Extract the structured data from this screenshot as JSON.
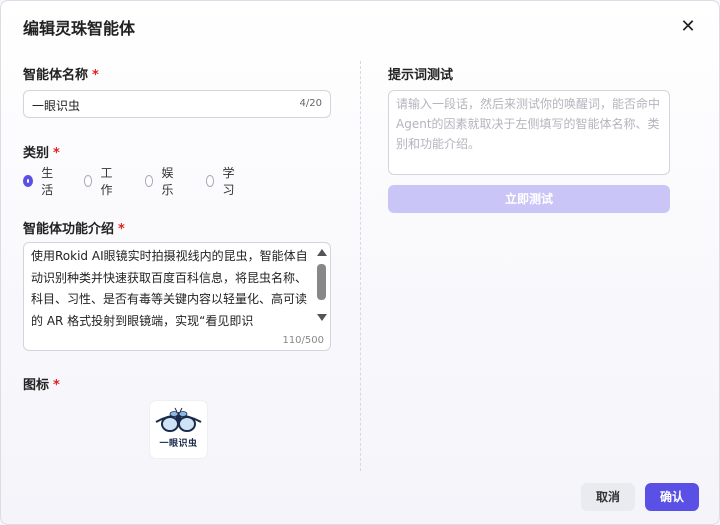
{
  "dialog": {
    "title": "编辑灵珠智能体",
    "close_symbol": "✕"
  },
  "name_field": {
    "label": "智能体名称",
    "required_mark": "*",
    "value": "一眼识虫",
    "counter": "4/20"
  },
  "category": {
    "label": "类别",
    "required_mark": "*",
    "options": [
      "生活",
      "工作",
      "娱乐",
      "学习"
    ],
    "selected": "生活"
  },
  "description": {
    "label": "智能体功能介绍",
    "required_mark": "*",
    "value": "使用Rokid AI眼镜实时拍摄视线内的昆虫，智能体自动识别种类并快速获取百度百科信息，将昆虫名称、科目、习性、是否有毒等关键内容以轻量化、高可读的 AR 格式投射到眼镜端，实现“看见即识",
    "counter": "110/500"
  },
  "icon_field": {
    "label": "图标",
    "required_mark": "*",
    "logo_text": "一眼识虫"
  },
  "prompt_test": {
    "label": "提示词测试",
    "placeholder": "请输入一段话，然后来测试你的唤醒词，能否命中Agent的因素就取决于左侧填写的智能体名称、类别和功能介绍。",
    "test_button": "立即测试"
  },
  "footer": {
    "cancel": "取消",
    "confirm": "确认"
  },
  "colors": {
    "accent": "#5b50e6",
    "accent_disabled": "#c9c6f7",
    "required": "#e02020"
  },
  "icons": [
    "close-icon",
    "radio-icon",
    "scroll-up-icon",
    "scroll-down-icon",
    "bee-glasses-logo-icon"
  ]
}
